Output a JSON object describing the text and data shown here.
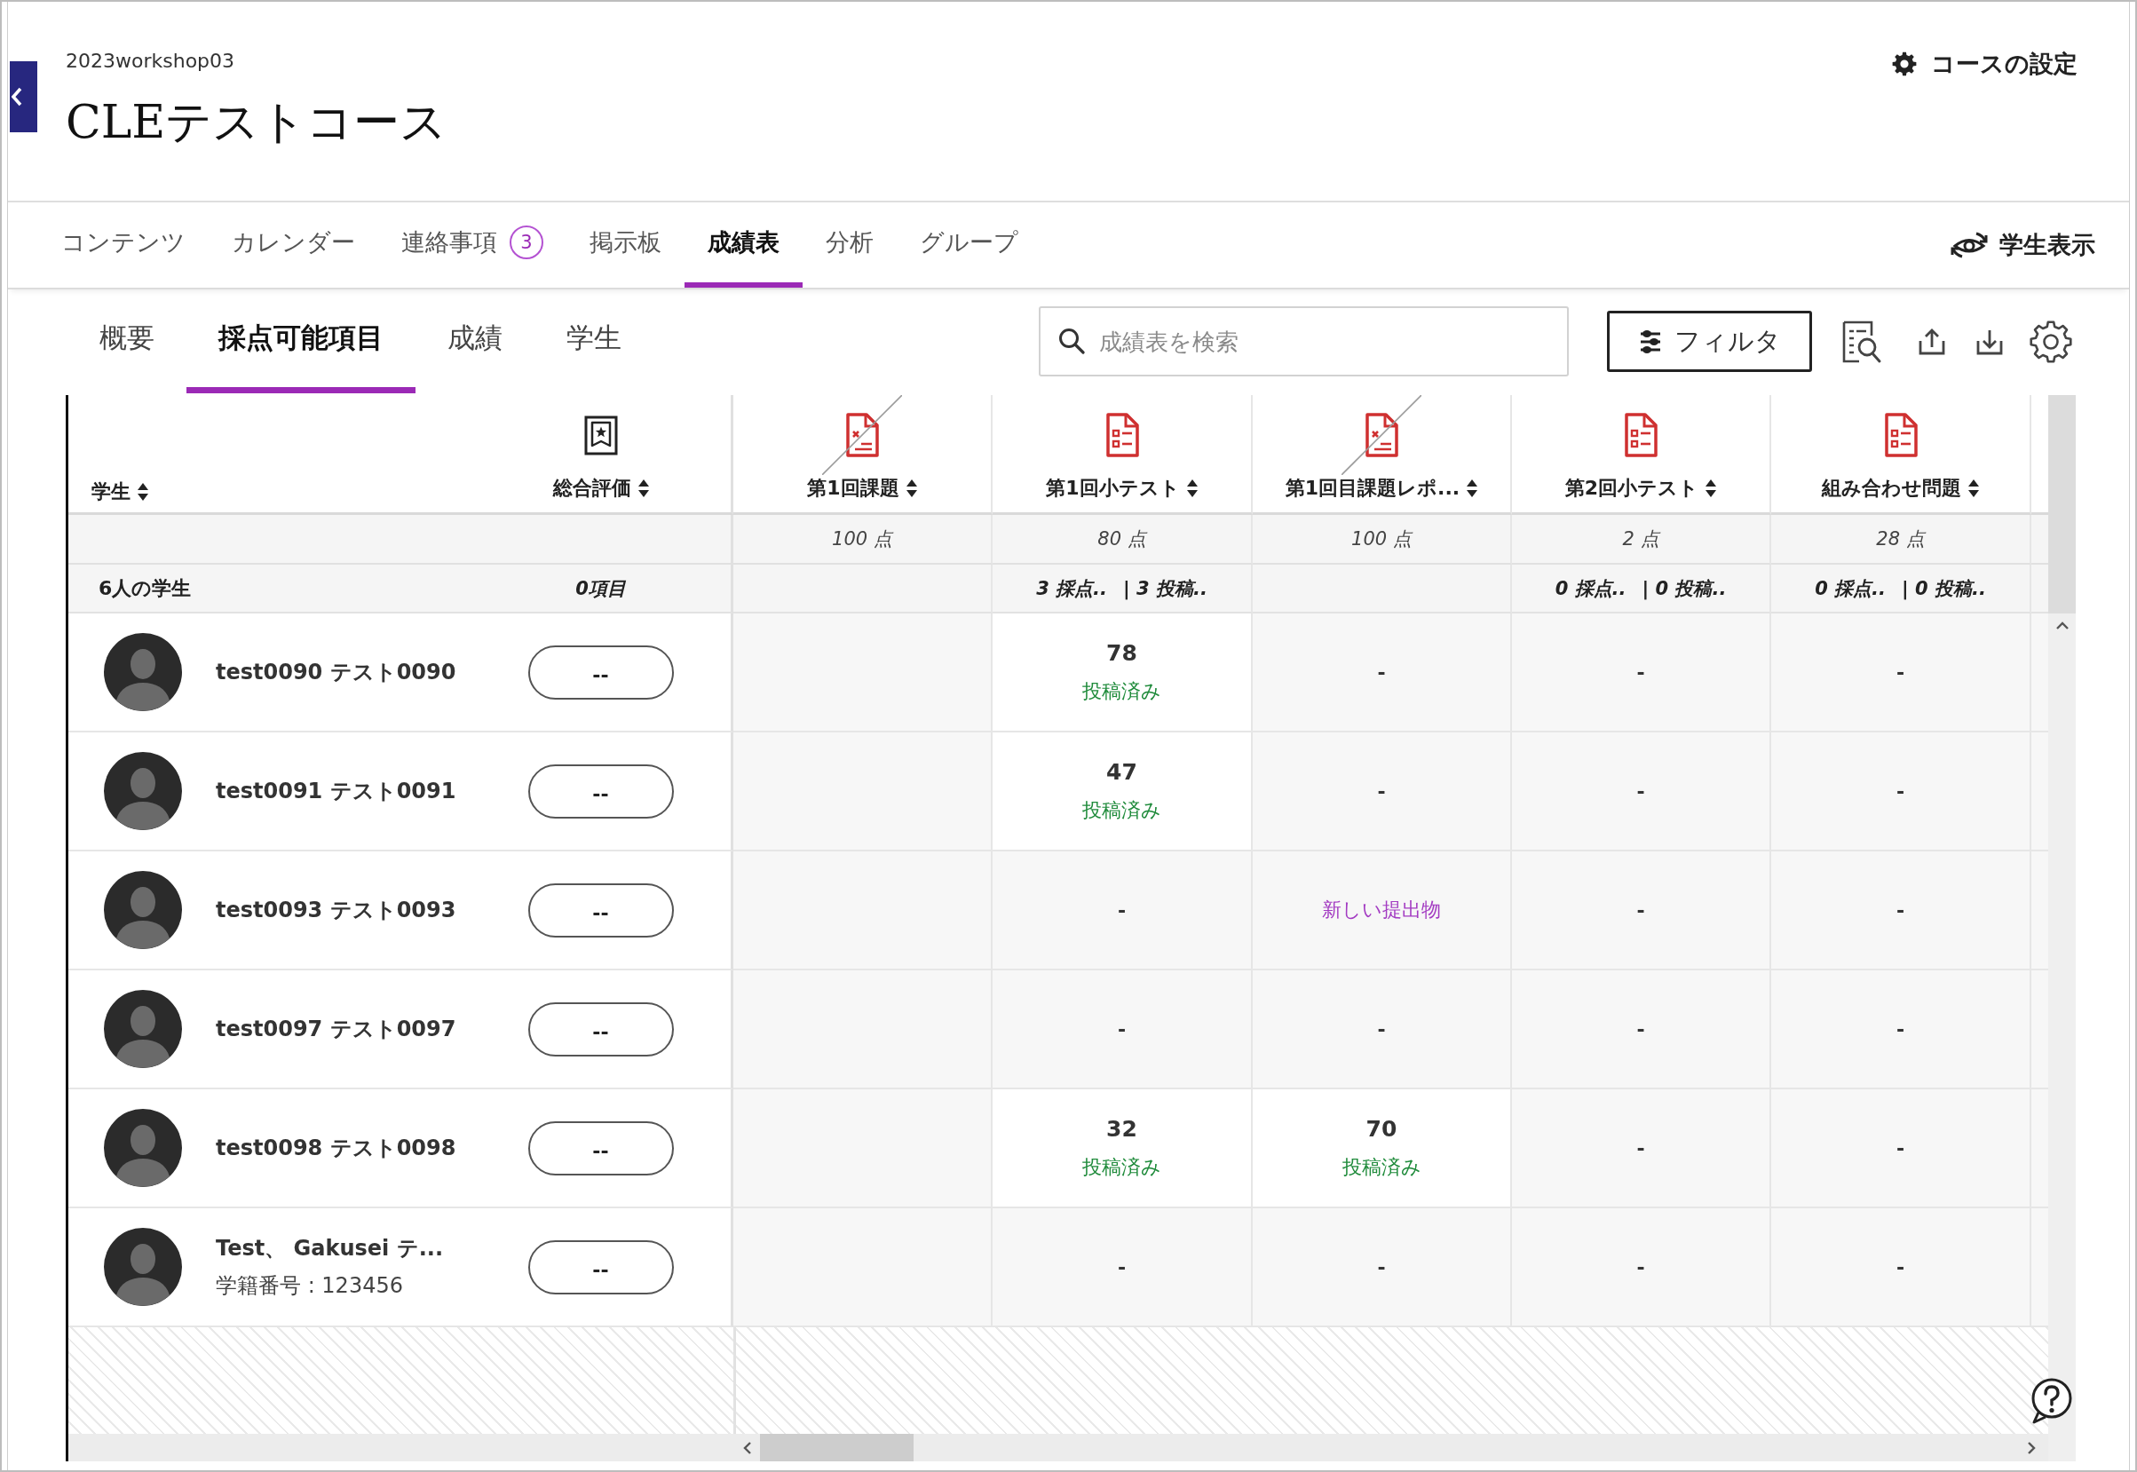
{
  "course": {
    "code": "2023workshop03",
    "title": "CLEテストコース",
    "settings_label": "コースの設定"
  },
  "nav": {
    "tabs": [
      {
        "label": "コンテンツ",
        "selected": false
      },
      {
        "label": "カレンダー",
        "selected": false
      },
      {
        "label": "連絡事項",
        "selected": false,
        "badge": "3"
      },
      {
        "label": "掲示板",
        "selected": false
      },
      {
        "label": "成績表",
        "selected": true
      },
      {
        "label": "分析",
        "selected": false
      },
      {
        "label": "グループ",
        "selected": false
      }
    ],
    "student_view_label": "学生表示"
  },
  "gradebook_tabs": [
    {
      "label": "概要",
      "selected": false
    },
    {
      "label": "採点可能項目",
      "selected": true
    },
    {
      "label": "成績",
      "selected": false
    },
    {
      "label": "学生",
      "selected": false
    }
  ],
  "search": {
    "placeholder": "成績表を検索"
  },
  "filter_label": "フィルタ",
  "grid": {
    "student_header": "学生",
    "overall_header": "総合評価",
    "student_count": "6人の学生",
    "overall_count": "0項目",
    "columns": [
      {
        "title": "第1回課題",
        "kind": "assignment",
        "hidden": true,
        "points": "100 点"
      },
      {
        "title": "第1回小テスト",
        "kind": "test",
        "hidden": false,
        "points": "80 点",
        "graded": "3 採点..",
        "submitted": "| 3 投稿.."
      },
      {
        "title": "第1回目課題レポ...",
        "kind": "assignment",
        "hidden": true,
        "points": "100 点"
      },
      {
        "title": "第2回小テスト",
        "kind": "test",
        "hidden": false,
        "points": "2 点",
        "graded": "0 採点..",
        "submitted": "| 0 投稿.."
      },
      {
        "title": "組み合わせ問題",
        "kind": "test",
        "hidden": false,
        "points": "28 点",
        "graded": "0 採点..",
        "submitted": "| 0 投稿.."
      }
    ],
    "rows": [
      {
        "name": "test0090 テスト0090",
        "overall": "--",
        "cells": [
          {
            "kind": "blank"
          },
          {
            "kind": "graded",
            "score": "78",
            "status": "投稿済み"
          },
          {
            "kind": "dash",
            "text": "-"
          },
          {
            "kind": "dash",
            "text": "-"
          },
          {
            "kind": "dash",
            "text": "-"
          }
        ]
      },
      {
        "name": "test0091 テスト0091",
        "overall": "--",
        "cells": [
          {
            "kind": "blank"
          },
          {
            "kind": "graded",
            "score": "47",
            "status": "投稿済み"
          },
          {
            "kind": "dash",
            "text": "-"
          },
          {
            "kind": "dash",
            "text": "-"
          },
          {
            "kind": "dash",
            "text": "-"
          }
        ]
      },
      {
        "name": "test0093 テスト0093",
        "overall": "--",
        "cells": [
          {
            "kind": "blank"
          },
          {
            "kind": "dash",
            "text": "-"
          },
          {
            "kind": "new",
            "status": "新しい提出物"
          },
          {
            "kind": "dash",
            "text": "-"
          },
          {
            "kind": "dash",
            "text": "-"
          }
        ]
      },
      {
        "name": "test0097 テスト0097",
        "overall": "--",
        "cells": [
          {
            "kind": "blank"
          },
          {
            "kind": "dash",
            "text": "-"
          },
          {
            "kind": "dash",
            "text": "-"
          },
          {
            "kind": "dash",
            "text": "-"
          },
          {
            "kind": "dash",
            "text": "-"
          }
        ]
      },
      {
        "name": "test0098 テスト0098",
        "overall": "--",
        "cells": [
          {
            "kind": "blank"
          },
          {
            "kind": "graded",
            "score": "32",
            "status": "投稿済み"
          },
          {
            "kind": "graded",
            "score": "70",
            "status": "投稿済み"
          },
          {
            "kind": "dash",
            "text": "-"
          },
          {
            "kind": "dash",
            "text": "-"
          }
        ]
      },
      {
        "name": "Test、 Gakusei テ...",
        "student_id": "学籍番号 : 123456",
        "overall": "--",
        "cells": [
          {
            "kind": "blank"
          },
          {
            "kind": "dash",
            "text": "-"
          },
          {
            "kind": "dash",
            "text": "-"
          },
          {
            "kind": "dash",
            "text": "-"
          },
          {
            "kind": "dash",
            "text": "-"
          }
        ]
      }
    ]
  }
}
